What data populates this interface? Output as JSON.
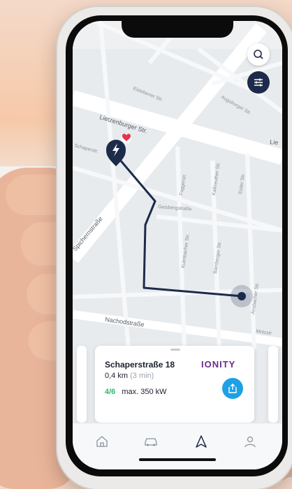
{
  "colors": {
    "route": "#1c2b4a",
    "accent_blue": "#1da0e5",
    "available_green": "#2eb872",
    "brand_purple": "#6a2c8c",
    "favorite_red": "#e8334a"
  },
  "map": {
    "streets": [
      "Lietzenburger Str.",
      "Schaperstr.",
      "Geisbergstraße",
      "Spichernstraße",
      "Nachodstraße",
      "Eislebener Str.",
      "Augsburger Str.",
      "Fuggerstr.",
      "Kalkreuther Str.",
      "Eisler Str.",
      "Bamberger Str.",
      "Kulmbacher Str.",
      "Ansbacher Str.",
      "Motzstr",
      "Lie"
    ],
    "icons": {
      "search": "search-icon",
      "filter": "sliders-icon",
      "charging_pin": "charging-station-pin-icon",
      "favorite": "heart-icon",
      "current_location": "location-dot-icon"
    }
  },
  "card": {
    "station_name": "Schaperstraße 18",
    "distance": "0,4 km",
    "duration": "(3 min)",
    "available": "4/6",
    "max_power": "max. 350 kW",
    "brand": "IONITY",
    "share_icon": "share-icon"
  },
  "tabbar": {
    "tabs": [
      {
        "icon": "home-icon"
      },
      {
        "icon": "car-icon"
      },
      {
        "icon": "navigation-arrow-icon"
      },
      {
        "icon": "profile-icon"
      }
    ],
    "active_index": 2
  }
}
